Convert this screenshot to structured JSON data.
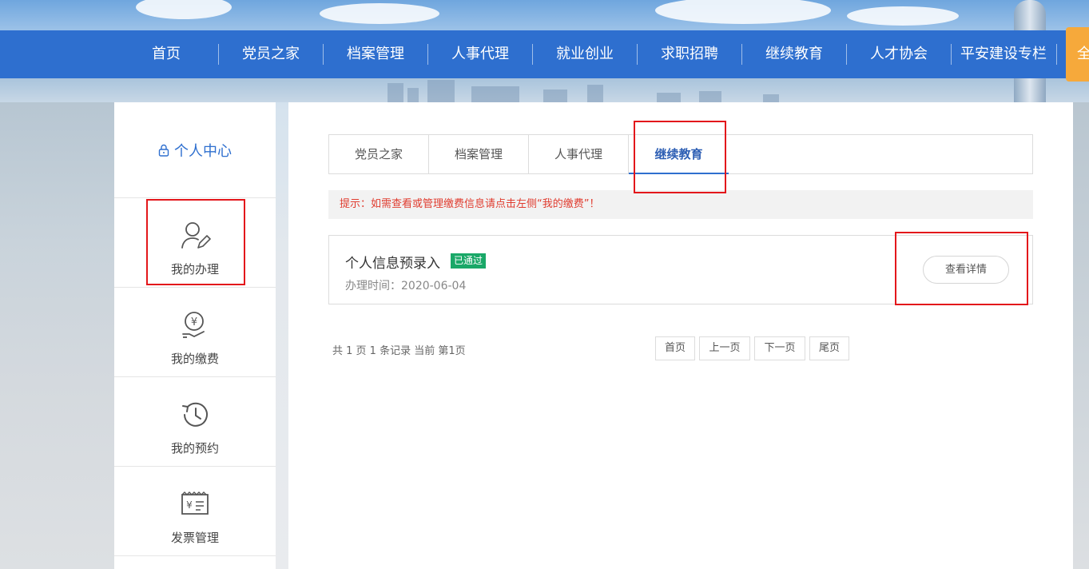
{
  "nav": {
    "items": [
      "首页",
      "党员之家",
      "档案管理",
      "人事代理",
      "就业创业",
      "求职招聘",
      "继续教育",
      "人才协会",
      "平安建设专栏"
    ],
    "extra_label": "全"
  },
  "sidebar": {
    "title": "个人中心",
    "items": [
      {
        "label": "我的办理",
        "icon": "user-edit-icon"
      },
      {
        "label": "我的缴费",
        "icon": "payment-hand-icon"
      },
      {
        "label": "我的预约",
        "icon": "history-clock-icon"
      },
      {
        "label": "发票管理",
        "icon": "invoice-icon"
      }
    ]
  },
  "tabs": [
    {
      "label": "党员之家",
      "active": false
    },
    {
      "label": "档案管理",
      "active": false
    },
    {
      "label": "人事代理",
      "active": false
    },
    {
      "label": "继续教育",
      "active": true
    }
  ],
  "tip": "提示：如需查看或管理缴费信息请点击左侧“我的缴费”！",
  "record": {
    "title": "个人信息预录入",
    "status": "已通过",
    "time_label": "办理时间：2020-06-04",
    "detail_button": "查看详情"
  },
  "pagination": {
    "summary": "共 1 页 1 条记录 当前 第1页",
    "first": "首页",
    "prev": "上一页",
    "next": "下一页",
    "last": "尾页"
  },
  "colors": {
    "nav_bg": "#2e6fcf",
    "accent": "#2e6fcf",
    "tip_text": "#e03c2f",
    "badge_bg": "#1aa868",
    "orange": "#f6a93b",
    "annotation": "#e3171b"
  }
}
